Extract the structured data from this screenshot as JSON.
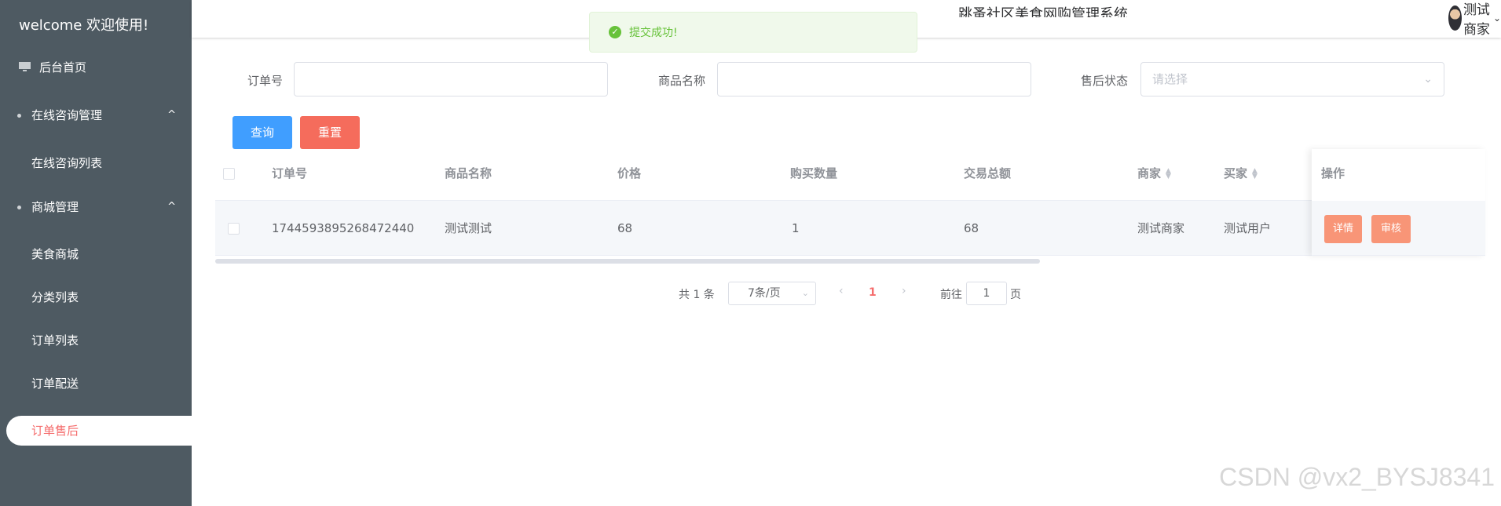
{
  "sidebar": {
    "welcome": "welcome 欢迎使用!",
    "items": [
      {
        "label": "后台首页"
      },
      {
        "label": "在线咨询管理",
        "caret": "^"
      },
      {
        "label": "在线咨询列表"
      },
      {
        "label": "商城管理",
        "caret": "^"
      },
      {
        "label": "美食商城"
      },
      {
        "label": "分类列表"
      },
      {
        "label": "订单列表"
      },
      {
        "label": "订单配送"
      },
      {
        "label": "订单售后"
      }
    ]
  },
  "header": {
    "system_title": "跳蚤社区美食网购管理系统",
    "user_name": "测试商家"
  },
  "toast": {
    "message": "提交成功!"
  },
  "search": {
    "order_no_label": "订单号",
    "order_no_value": "",
    "product_name_label": "商品名称",
    "product_name_value": "",
    "after_sale_label": "售后状态",
    "after_sale_placeholder": "请选择",
    "query_label": "查询",
    "reset_label": "重置"
  },
  "table": {
    "columns": [
      "订单号",
      "商品名称",
      "价格",
      "购买数量",
      "交易总额",
      "商家",
      "买家",
      "操作"
    ],
    "rows": [
      {
        "order_no": "1744593895268472440",
        "product_name": "测试测试",
        "price": "68",
        "quantity": "1",
        "total": "68",
        "merchant": "测试商家",
        "buyer": "测试用户",
        "actions": [
          "详情",
          "审核"
        ]
      }
    ]
  },
  "pagination": {
    "total": "共 1 条",
    "page_size": "7条/页",
    "current_page": "1",
    "goto_label": "前往",
    "goto_value": "1",
    "page_suffix": "页"
  },
  "watermark": "CSDN @vx2_BYSJ8341",
  "colors": {
    "sidebar_bg": "#4e5a62",
    "primary": "#409eff",
    "danger": "#f56c5c",
    "active_text": "#f56c6c",
    "success": "#67c23a",
    "action_button": "#f89577"
  }
}
